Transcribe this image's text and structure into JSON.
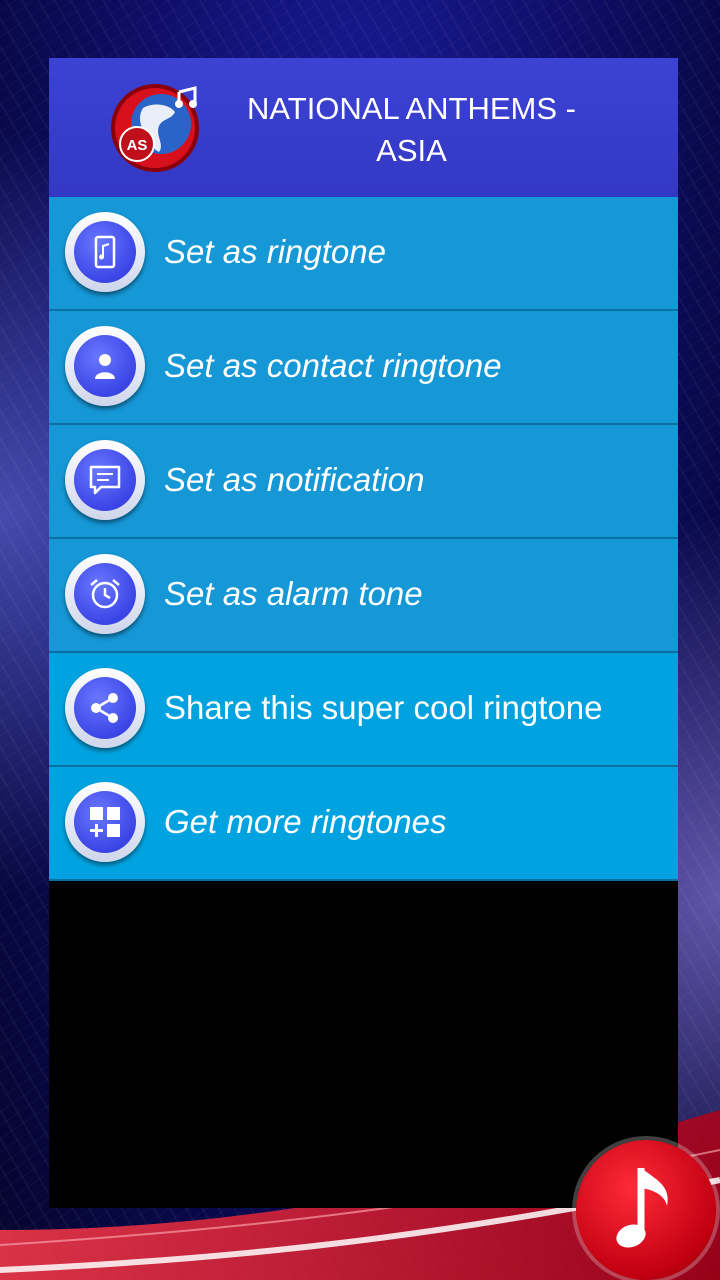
{
  "header": {
    "title_line1": "NATIONAL ANTHEMS -",
    "title_line2": "ASIA",
    "logo_text": "AS"
  },
  "menu": {
    "items": [
      {
        "label": "Set as ringtone",
        "icon": "phone-music-icon"
      },
      {
        "label": "Set as contact ringtone",
        "icon": "contact-icon"
      },
      {
        "label": "Set as notification",
        "icon": "message-icon"
      },
      {
        "label": "Set as alarm tone",
        "icon": "alarm-clock-icon"
      },
      {
        "label": "Share this super cool ringtone",
        "icon": "share-icon"
      },
      {
        "label": "Get more ringtones",
        "icon": "apps-add-icon"
      }
    ]
  },
  "colors": {
    "header": "#3c42d3",
    "row": "#1697d6",
    "row_alt": "#00a3e0",
    "icon_fill": "#3b45e6",
    "fab": "#d40012"
  },
  "fab": {
    "icon": "music-note-icon"
  }
}
